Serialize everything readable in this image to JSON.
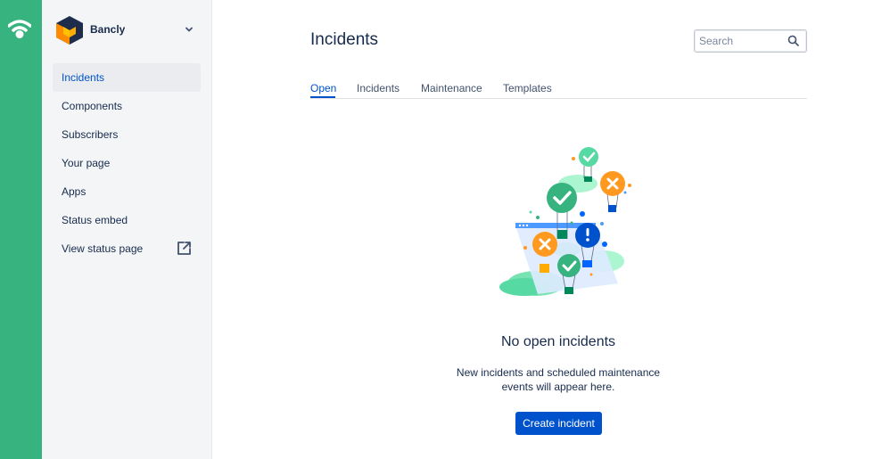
{
  "app": {
    "brand_name": "Bancly"
  },
  "sidebar": {
    "items": [
      {
        "label": "Incidents",
        "active": true
      },
      {
        "label": "Components"
      },
      {
        "label": "Subscribers"
      },
      {
        "label": "Your page"
      },
      {
        "label": "Apps"
      },
      {
        "label": "Status embed"
      },
      {
        "label": "View status page",
        "icon": "external-link-icon"
      }
    ]
  },
  "header": {
    "title": "Incidents",
    "search_placeholder": "Search"
  },
  "tabs": [
    {
      "label": "Open",
      "active": true
    },
    {
      "label": "Incidents"
    },
    {
      "label": "Maintenance"
    },
    {
      "label": "Templates"
    }
  ],
  "empty_state": {
    "title": "No open incidents",
    "description_line1": "New incidents and scheduled maintenance",
    "description_line2": "events will appear here.",
    "button_label": "Create incident"
  },
  "colors": {
    "rail": "#36B37E",
    "sidebar_bg": "#F4F5F7",
    "primary": "#0052CC",
    "text": "#172B4D"
  },
  "icons": {
    "rail_logo": "statuspage-logo-icon",
    "brand_logo": "bancly-logo-icon",
    "dropdown": "chevron-down-icon",
    "search": "search-icon",
    "external_link": "external-link-icon"
  }
}
